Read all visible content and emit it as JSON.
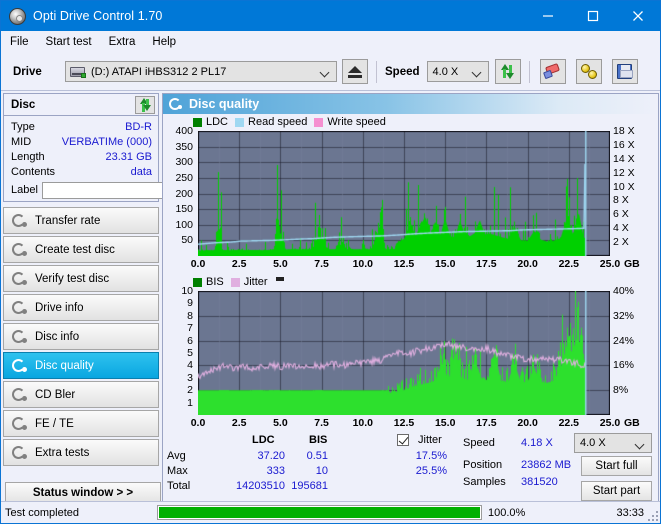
{
  "window": {
    "title": "Opti Drive Control 1.70",
    "app_icon": "disc-icon",
    "minimize": "–",
    "maximize": "□",
    "close": "✕"
  },
  "menu": {
    "items": [
      {
        "label": "File"
      },
      {
        "label": "Start test"
      },
      {
        "label": "Extra"
      },
      {
        "label": "Help"
      }
    ]
  },
  "toolbar": {
    "drive_label": "Drive",
    "drive_value": "(D:)   ATAPI iHBS312  2 PL17",
    "eject_icon": "eject-icon",
    "speed_label": "Speed",
    "speed_value": "4.0 X",
    "refresh_icon": "refresh-icon",
    "erase_icon": "eraser-icon",
    "cylinders_icon": "cylinders-icon",
    "save_icon": "floppy-save-icon"
  },
  "disc_panel": {
    "title": "Disc",
    "refresh_icon": "refresh-icon",
    "rows": [
      {
        "key": "Type",
        "value": "BD-R"
      },
      {
        "key": "MID",
        "value": "VERBATIMe (000)"
      },
      {
        "key": "Length",
        "value": "23.31 GB"
      },
      {
        "key": "Contents",
        "value": "data"
      }
    ],
    "label_key": "Label",
    "label_value": "",
    "label_placeholder": "",
    "label_button_icon": "disc-icon"
  },
  "sidebar": {
    "items": [
      {
        "label": "Transfer rate",
        "icon": "gear-icon",
        "active": false
      },
      {
        "label": "Create test disc",
        "icon": "gear-icon",
        "active": false
      },
      {
        "label": "Verify test disc",
        "icon": "gear-icon",
        "active": false
      },
      {
        "label": "Drive info",
        "icon": "gear-icon",
        "active": false
      },
      {
        "label": "Disc info",
        "icon": "gear-icon",
        "active": false
      },
      {
        "label": "Disc quality",
        "icon": "gear-icon",
        "active": true
      },
      {
        "label": "CD Bler",
        "icon": "gear-icon",
        "active": false
      },
      {
        "label": "FE / TE",
        "icon": "gear-icon",
        "active": false
      },
      {
        "label": "Extra tests",
        "icon": "gear-icon",
        "active": false
      }
    ],
    "status_window": "Status window > >"
  },
  "content": {
    "header_title": "Disc quality",
    "header_icon": "gear-icon"
  },
  "chart_data": [
    {
      "type": "area",
      "title": "LDC / Read speed",
      "legend": [
        {
          "label": "LDC",
          "color": "#008000"
        },
        {
          "label": "Read speed",
          "color": "#9fd8f2"
        },
        {
          "label": "Write speed",
          "color": "#f58fd0"
        }
      ],
      "legend_position": "top-left",
      "xlabel": "GB",
      "xlim": [
        0,
        25
      ],
      "xticks": [
        "0.0",
        "2.5",
        "5.0",
        "7.5",
        "10.0",
        "12.5",
        "15.0",
        "17.5",
        "20.0",
        "22.5",
        "25.0"
      ],
      "ylabel_left": "LDC",
      "ylim_left": [
        0,
        400
      ],
      "yticks_left": [
        "400",
        "350",
        "300",
        "250",
        "200",
        "150",
        "100",
        "50"
      ],
      "ylabel_right": "Speed",
      "ylim_right": [
        0,
        18
      ],
      "yticks_right": [
        "18 X",
        "16 X",
        "14 X",
        "12 X",
        "10 X",
        "8 X",
        "6 X",
        "4 X",
        "2 X"
      ],
      "grid": true,
      "plot_bg": "#6b7691",
      "data_end_gb": 23.5,
      "series": [
        {
          "name": "LDC",
          "color": "#00d000",
          "x": [
            0.0,
            0.5,
            1.0,
            1.2,
            1.5,
            2.0,
            2.5,
            3.0,
            3.5,
            4.0,
            4.5,
            4.95,
            5.3,
            5.8,
            6.3,
            6.8,
            7.3,
            7.8,
            8.3,
            8.8,
            9.1,
            9.5,
            10.0,
            10.5,
            10.9,
            11.3,
            11.8,
            12.2,
            12.5,
            12.9,
            13.2,
            13.5,
            13.8,
            14.1,
            14.4,
            14.7,
            15.0,
            15.3,
            15.6,
            15.9,
            16.2,
            16.5,
            16.8,
            17.1,
            17.4,
            17.7,
            18.0,
            18.4,
            18.8,
            19.2,
            19.6,
            20.0,
            20.4,
            20.8,
            21.2,
            21.6,
            22.0,
            22.4,
            22.8,
            23.1,
            23.4
          ],
          "values": [
            40,
            42,
            45,
            327,
            46,
            44,
            47,
            45,
            46,
            44,
            48,
            296,
            50,
            52,
            50,
            54,
            273,
            56,
            58,
            170,
            60,
            62,
            65,
            70,
            240,
            72,
            75,
            110,
            130,
            255,
            150,
            235,
            300,
            160,
            265,
            155,
            290,
            150,
            145,
            270,
            160,
            150,
            175,
            275,
            165,
            170,
            160,
            145,
            130,
            225,
            120,
            115,
            190,
            125,
            110,
            118,
            135,
            295,
            150,
            336,
            140
          ]
        },
        {
          "name": "Read speed",
          "color": "#9fd8f2",
          "x": [
            0.0,
            1.0,
            2.0,
            2.6,
            3.5,
            4.5,
            5.5,
            6.3,
            7.0,
            7.6,
            8.3,
            9.0,
            9.7,
            10.5,
            11.2,
            12.0,
            12.6,
            13.2,
            14.0,
            15.0,
            16.0,
            17.0,
            18.0,
            19.0,
            19.6,
            20.4,
            21.3,
            22.2,
            23.0,
            23.45,
            23.5
          ],
          "values": [
            1.7,
            1.9,
            2.0,
            2.15,
            2.2,
            2.25,
            2.35,
            2.45,
            2.5,
            2.6,
            2.7,
            2.75,
            2.8,
            2.85,
            2.9,
            3.0,
            3.1,
            3.2,
            3.3,
            3.4,
            3.5,
            3.55,
            3.6,
            3.65,
            3.75,
            3.8,
            3.85,
            3.9,
            3.95,
            4.0,
            18.0
          ]
        },
        {
          "name": "Write speed",
          "color": "#f58fd0",
          "x": [],
          "values": []
        }
      ]
    },
    {
      "type": "area",
      "title": "BIS / Jitter",
      "legend": [
        {
          "label": "BIS",
          "color": "#008000"
        },
        {
          "label": "Jitter",
          "color": "#e0afe0"
        }
      ],
      "legend_position": "top-left",
      "xlabel": "GB",
      "xlim": [
        0,
        25
      ],
      "xticks": [
        "0.0",
        "2.5",
        "5.0",
        "7.5",
        "10.0",
        "12.5",
        "15.0",
        "17.5",
        "20.0",
        "22.5",
        "25.0"
      ],
      "ylabel_left": "BIS",
      "ylim_left": [
        0,
        10
      ],
      "yticks_left": [
        "10",
        "9",
        "8",
        "7",
        "6",
        "5",
        "4",
        "3",
        "2",
        "1"
      ],
      "ylabel_right": "Jitter",
      "ylim_right": [
        0,
        40
      ],
      "yticks_right": [
        "40%",
        "32%",
        "24%",
        "16%",
        "8%"
      ],
      "grid": true,
      "plot_bg": "#6b7691",
      "data_end_gb": 23.5,
      "series": [
        {
          "name": "BIS",
          "color": "#2de02d",
          "x": [
            0.0,
            0.6,
            1.2,
            1.3,
            1.9,
            2.5,
            3.1,
            3.6,
            4.2,
            4.9,
            5.0,
            5.6,
            6.2,
            6.9,
            7.5,
            7.6,
            8.1,
            8.7,
            9.3,
            9.9,
            10.5,
            11.0,
            11.5,
            12.0,
            12.4,
            12.8,
            13.2,
            13.6,
            14.0,
            14.4,
            14.8,
            15.2,
            15.6,
            16.0,
            16.4,
            16.8,
            17.2,
            17.6,
            18.0,
            18.4,
            18.8,
            19.2,
            19.6,
            20.0,
            20.4,
            20.8,
            21.2,
            21.6,
            22.0,
            22.4,
            22.7,
            23.0,
            23.2,
            23.4
          ],
          "values": [
            2.0,
            2.0,
            2.0,
            6.0,
            2.0,
            2.0,
            2.0,
            6.0,
            2.0,
            6.0,
            2.0,
            2.0,
            2.0,
            2.0,
            6.0,
            2.0,
            2.0,
            2.0,
            2.0,
            2.0,
            2.2,
            2.5,
            2.8,
            3.0,
            3.2,
            3.5,
            3.8,
            4.0,
            4.2,
            4.5,
            6.9,
            4.6,
            8.1,
            4.8,
            4.6,
            7.2,
            4.8,
            4.5,
            8.2,
            4.4,
            4.3,
            6.8,
            4.2,
            4.4,
            6.1,
            4.3,
            4.2,
            4.5,
            6.1,
            9.2,
            8.2,
            10.0,
            9.3,
            7.2
          ]
        },
        {
          "name": "Jitter",
          "color": "#e0afe0",
          "x": [
            0.0,
            0.4,
            0.9,
            1.5,
            2.1,
            2.7,
            3.3,
            3.9,
            4.5,
            5.1,
            5.7,
            6.3,
            6.9,
            7.5,
            8.1,
            8.7,
            9.3,
            9.9,
            10.5,
            11.0,
            11.5,
            11.9,
            12.3,
            12.6,
            13.0,
            13.4,
            13.8,
            14.2,
            14.6,
            15.0,
            15.4,
            15.8,
            16.2,
            16.6,
            17.0,
            17.4,
            17.8,
            18.2,
            18.6,
            19.0,
            19.4,
            19.8,
            20.2,
            20.6,
            21.0,
            21.4,
            21.8,
            22.2,
            22.6,
            23.0,
            23.4
          ],
          "values": [
            3.1,
            3.4,
            3.7,
            3.9,
            3.8,
            3.9,
            3.8,
            3.9,
            4.0,
            3.9,
            4.0,
            3.9,
            4.0,
            3.9,
            4.1,
            4.0,
            4.1,
            4.2,
            4.3,
            4.4,
            4.6,
            4.8,
            5.0,
            5.1,
            5.0,
            5.2,
            5.3,
            5.4,
            5.6,
            5.8,
            5.6,
            5.5,
            5.4,
            5.5,
            5.3,
            5.4,
            5.2,
            5.0,
            4.9,
            4.7,
            4.6,
            4.5,
            4.5,
            4.4,
            4.5,
            4.4,
            4.5,
            4.4,
            4.3,
            4.2,
            4.0
          ]
        }
      ]
    }
  ],
  "stats": {
    "col_ldc": "LDC",
    "col_bis": "BIS",
    "jitter_label": "Jitter",
    "jitter_checked": true,
    "rows": [
      {
        "label": "Avg",
        "ldc": "37.20",
        "bis": "0.51",
        "jitter": "17.5%"
      },
      {
        "label": "Max",
        "ldc": "333",
        "bis": "10",
        "jitter": "25.5%"
      },
      {
        "label": "Total",
        "ldc": "14203510",
        "bis": "195681",
        "jitter": ""
      }
    ],
    "speed_label": "Speed",
    "speed_value": "4.18 X",
    "position_label": "Position",
    "position_value": "23862 MB",
    "samples_label": "Samples",
    "samples_value": "381520",
    "speed_select": "4.0 X",
    "start_full": "Start full",
    "start_part": "Start part"
  },
  "statusbar": {
    "text": "Test completed",
    "progress_pct": "100.0%",
    "progress_value": 100,
    "elapsed": "33:33"
  }
}
